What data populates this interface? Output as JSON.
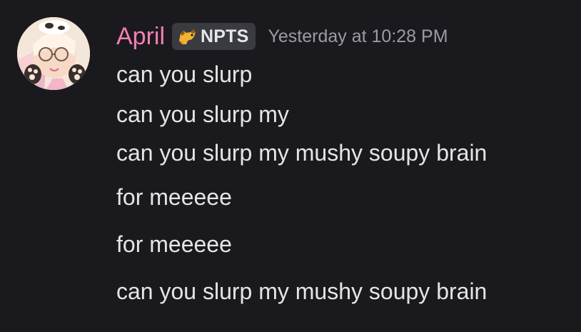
{
  "message": {
    "author": "April",
    "author_color": "#f47fb6",
    "tag": {
      "icon": "dog-icon",
      "label": "NPTS"
    },
    "timestamp": "Yesterday at 10:28 PM",
    "lines": [
      "can you slurp",
      "can you slurp my",
      "can you slurp my mushy soupy brain",
      "for meeeee",
      "for meeeee",
      "can you slurp my mushy soupy brain"
    ]
  }
}
